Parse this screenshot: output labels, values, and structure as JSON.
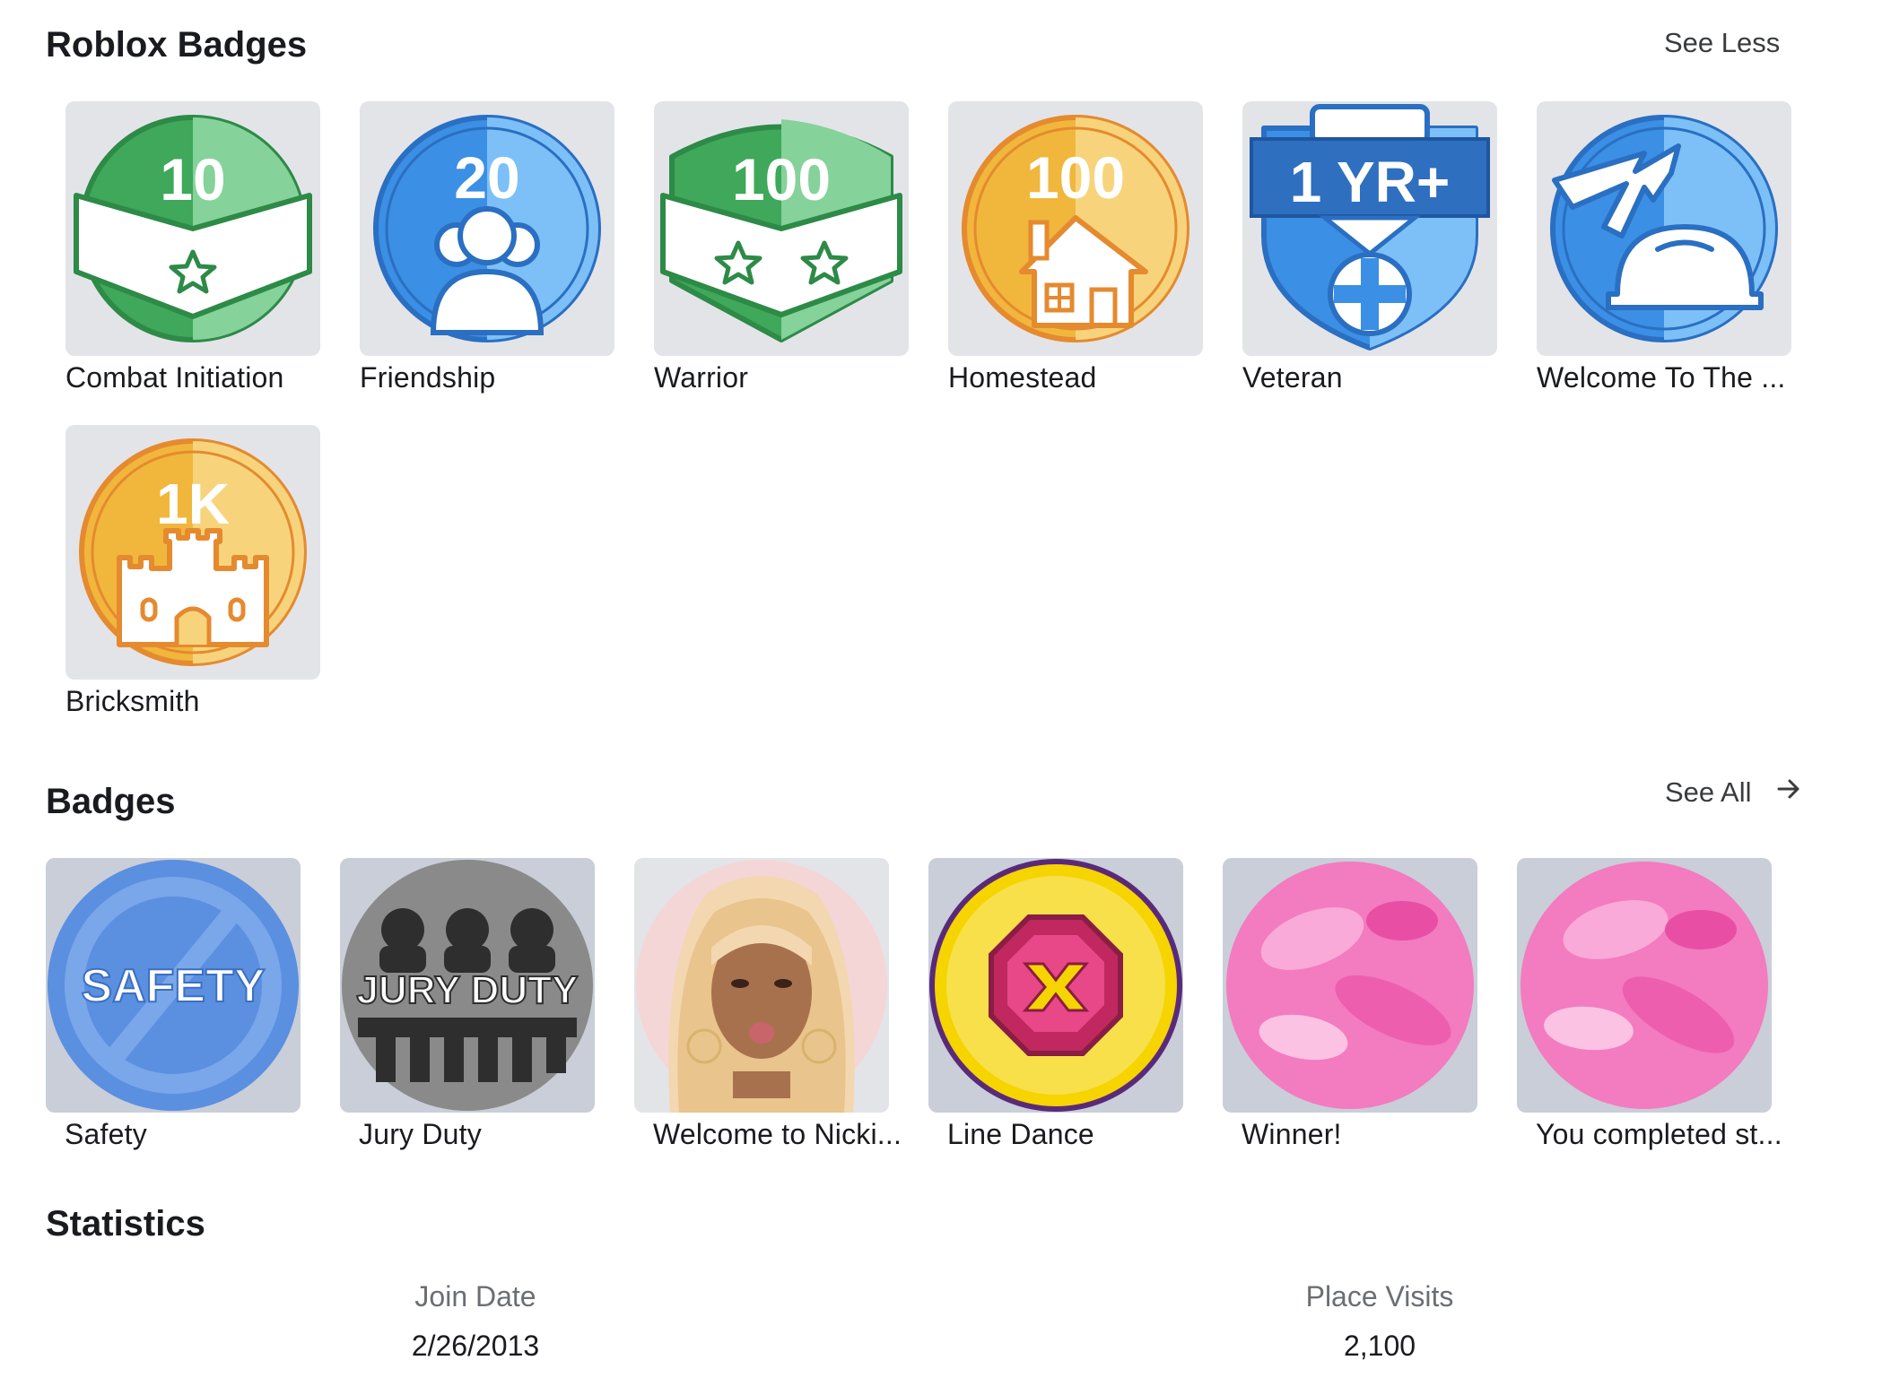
{
  "roblox_badges": {
    "title": "Roblox Badges",
    "toggle_label": "See Less",
    "items": [
      {
        "name": "Combat Initiation",
        "icon": "combat-initiation-icon",
        "number": "10"
      },
      {
        "name": "Friendship",
        "icon": "friendship-icon",
        "number": "20"
      },
      {
        "name": "Warrior",
        "icon": "warrior-icon",
        "number": "100"
      },
      {
        "name": "Homestead",
        "icon": "homestead-icon",
        "number": "100"
      },
      {
        "name": "Veteran",
        "icon": "veteran-icon",
        "number": "1 YR+"
      },
      {
        "name": "Welcome To The ...",
        "icon": "builders-club-icon"
      },
      {
        "name": "Bricksmith",
        "icon": "bricksmith-icon",
        "number": "1K"
      }
    ]
  },
  "badges": {
    "title": "Badges",
    "see_all_label": "See All",
    "items": [
      {
        "name": "Safety",
        "icon": "safety-badge-icon",
        "art_text": "SAFETY"
      },
      {
        "name": "Jury Duty",
        "icon": "jury-duty-badge-icon",
        "art_text": "JURY DUTY"
      },
      {
        "name": "Welcome to Nicki...",
        "icon": "portrait-badge-icon"
      },
      {
        "name": "Line Dance",
        "icon": "line-dance-badge-icon"
      },
      {
        "name": "Winner!",
        "icon": "pink-badge-icon"
      },
      {
        "name": "You completed st...",
        "icon": "pink-badge-icon"
      }
    ]
  },
  "statistics": {
    "title": "Statistics",
    "join_date_label": "Join Date",
    "join_date_value": "2/26/2013",
    "place_visits_label": "Place Visits",
    "place_visits_value": "2,100"
  },
  "colors": {
    "green": "#3fa85a",
    "blue": "#3b8fe5",
    "gold": "#f0b73c",
    "tile_bg": "#e3e4e8"
  }
}
